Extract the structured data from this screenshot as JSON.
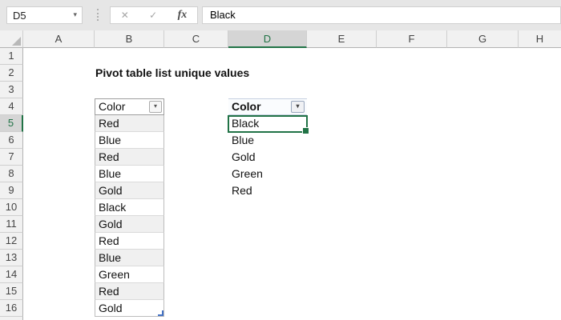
{
  "formula_bar": {
    "name_box_value": "D5",
    "name_box_arrow": "▾",
    "cancel_icon": "✕",
    "enter_icon": "✓",
    "fx_icon": "fx",
    "formula_value": "Black"
  },
  "grid": {
    "columns": [
      "A",
      "B",
      "C",
      "D",
      "E",
      "F",
      "G",
      "H"
    ],
    "rows": [
      "1",
      "2",
      "3",
      "4",
      "5",
      "6",
      "7",
      "8",
      "9",
      "10",
      "11",
      "12",
      "13",
      "14",
      "15",
      "16"
    ],
    "selected_cell": "D5",
    "selected_column": "D",
    "selected_row": "5"
  },
  "sheet": {
    "title": "Pivot table list unique values",
    "source_table": {
      "header": "Color",
      "filter_arrow": "▾",
      "values": [
        "Red",
        "Blue",
        "Red",
        "Blue",
        "Gold",
        "Black",
        "Gold",
        "Red",
        "Blue",
        "Green",
        "Red",
        "Gold"
      ]
    },
    "pivot_table": {
      "header": "Color",
      "filter_arrow": "▾",
      "values": [
        "Black",
        "Blue",
        "Gold",
        "Green",
        "Red"
      ]
    }
  },
  "colors": {
    "accent_green": "#217346",
    "band_fill": "#f0f0f0",
    "topbar_fill": "#e6e6e6",
    "header_fill": "#f1f1f1",
    "selected_header_fill": "#d5d5d5",
    "pivot_header_fill": "#fafcfe",
    "table_resize_handle": "#4472c4"
  }
}
